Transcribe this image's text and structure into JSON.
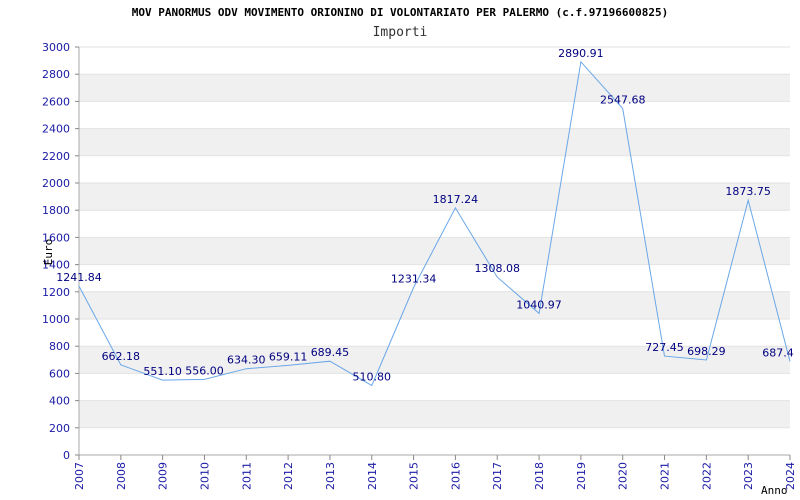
{
  "chart_data": {
    "type": "line",
    "title": "MOV PANORMUS ODV MOVIMENTO ORIONINO DI VOLONTARIATO PER PALERMO (c.f.97196600825)",
    "subtitle": "Importi",
    "xlabel": "Anno",
    "ylabel": "Euro",
    "ylim": [
      0,
      3000
    ],
    "ytick_step": 200,
    "grid": true,
    "x": [
      "2007",
      "2008",
      "2009",
      "2010",
      "2011",
      "2012",
      "2013",
      "2014",
      "2015",
      "2016",
      "2017",
      "2018",
      "2019",
      "2020",
      "2021",
      "2022",
      "2023",
      "2024"
    ],
    "values": [
      1241.84,
      662.18,
      551.1,
      556.0,
      634.3,
      659.11,
      689.45,
      510.8,
      1231.34,
      1817.24,
      1308.08,
      1040.97,
      2890.91,
      2547.68,
      727.45,
      698.29,
      1873.75,
      687.4
    ],
    "value_labels": [
      "1241.84",
      "662.18",
      "551.10",
      "556.00",
      "634.30",
      "659.11",
      "689.45",
      "510.80",
      "1231.34",
      "1817.24",
      "1308.08",
      "1040.97",
      "2890.91",
      "2547.68",
      "727.45",
      "698.29",
      "1873.75",
      "687.4"
    ],
    "line_color": "#6aa7e8",
    "band_color": "#f0f0f0",
    "tick_color": "#1a1aa6"
  }
}
